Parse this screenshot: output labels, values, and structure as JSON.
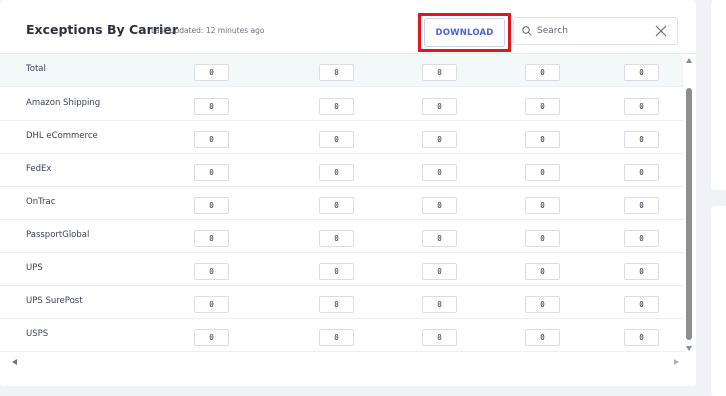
{
  "header": {
    "title": "Exceptions By Carrier",
    "last_updated": "Last Updated: 12 minutes ago",
    "download_label": "DOWNLOAD"
  },
  "search": {
    "placeholder": "Search",
    "value": ""
  },
  "rows": [
    {
      "label": "Total",
      "values": [
        "0",
        "0",
        "0",
        "0",
        "0"
      ]
    },
    {
      "label": "Amazon Shipping",
      "values": [
        "0",
        "0",
        "0",
        "0",
        "0"
      ]
    },
    {
      "label": "DHL eCommerce",
      "values": [
        "0",
        "0",
        "0",
        "0",
        "0"
      ]
    },
    {
      "label": "FedEx",
      "values": [
        "0",
        "0",
        "0",
        "0",
        "0"
      ]
    },
    {
      "label": "OnTrac",
      "values": [
        "0",
        "0",
        "0",
        "0",
        "0"
      ]
    },
    {
      "label": "PassportGlobal",
      "values": [
        "0",
        "0",
        "0",
        "0",
        "0"
      ]
    },
    {
      "label": "UPS",
      "values": [
        "0",
        "0",
        "0",
        "0",
        "0"
      ]
    },
    {
      "label": "UPS SurePost",
      "values": [
        "0",
        "0",
        "0",
        "0",
        "0"
      ]
    },
    {
      "label": "USPS",
      "values": [
        "0",
        "0",
        "0",
        "0",
        "0"
      ]
    }
  ],
  "colors": {
    "highlight_border": "#e0161c",
    "accent": "#4a63d6"
  },
  "icons": {
    "search": "search-icon",
    "clear": "close-icon"
  }
}
